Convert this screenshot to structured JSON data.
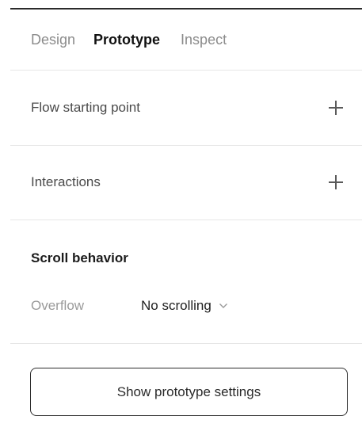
{
  "tabs": [
    {
      "label": "Design",
      "active": false
    },
    {
      "label": "Prototype",
      "active": true
    },
    {
      "label": "Inspect",
      "active": false
    }
  ],
  "sections": {
    "flow_starting_point": {
      "label": "Flow starting point",
      "icon": "plus-icon"
    },
    "interactions": {
      "label": "Interactions",
      "icon": "plus-icon"
    }
  },
  "scroll_behavior": {
    "title": "Scroll behavior",
    "overflow_label": "Overflow",
    "overflow_value": "No scrolling",
    "dropdown_icon": "chevron-down-icon"
  },
  "footer": {
    "show_settings_label": "Show prototype settings"
  },
  "colors": {
    "active_tab": "#111111",
    "inactive_tab": "#8b8b8b",
    "divider": "#e6e6e6",
    "button_border": "#2d2d2d"
  }
}
